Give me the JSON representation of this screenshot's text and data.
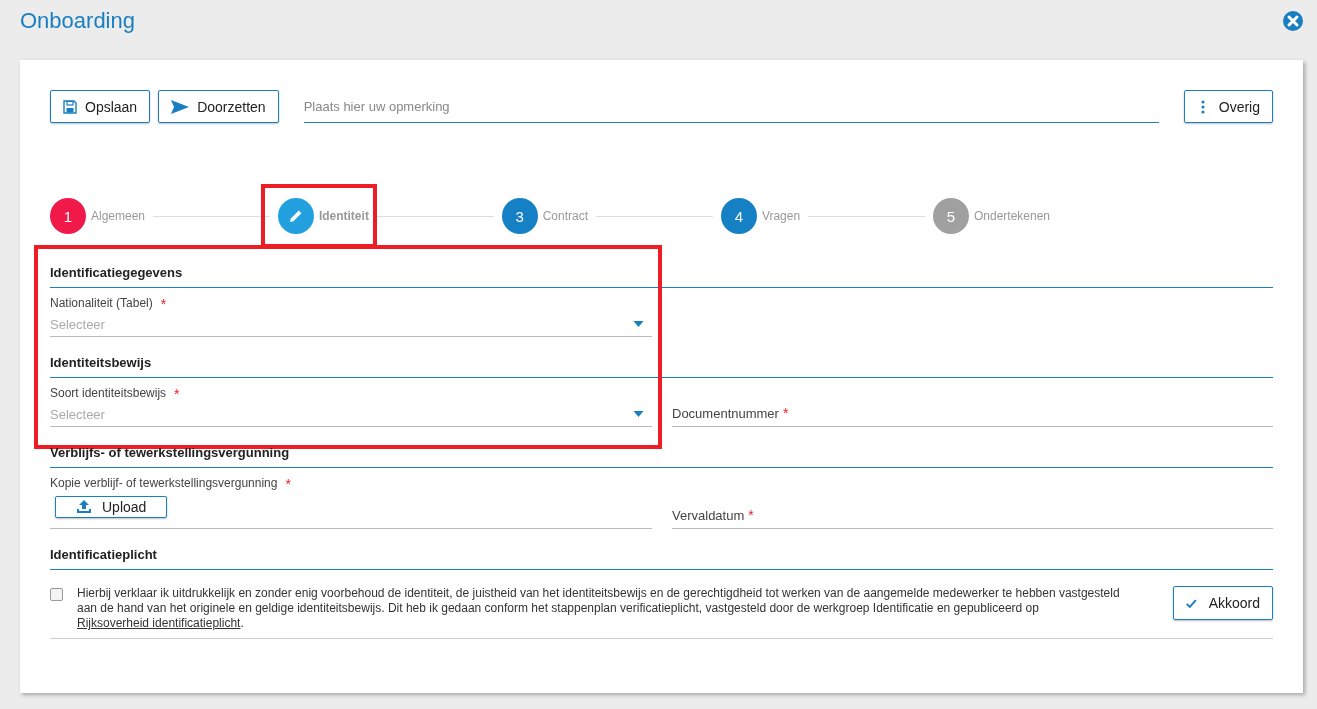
{
  "window": {
    "title": "Onboarding"
  },
  "toolbar": {
    "buttons": [
      {
        "label": "Opslaan",
        "kind": "save"
      },
      {
        "label": "Doorzetten",
        "kind": "send"
      }
    ],
    "remark": {
      "placeholder": "Plaats hier uw opmerking"
    },
    "more_button": {
      "label": "Overig"
    }
  },
  "steps": [
    {
      "kind": "number",
      "number": "1",
      "label": "Algemeen",
      "color": "#f0194a",
      "selected": false,
      "highlighted": false
    },
    {
      "kind": "pencil",
      "label": "Identiteit",
      "color": "#23a0e0",
      "selected": true,
      "highlighted": true
    },
    {
      "kind": "number",
      "number": "3",
      "label": "Contract",
      "color": "#1580c4",
      "selected": false,
      "highlighted": false
    },
    {
      "kind": "number",
      "number": "4",
      "label": "Vragen",
      "color": "#1580c4",
      "selected": false,
      "highlighted": false
    },
    {
      "kind": "number",
      "number": "5",
      "label": "Ondertekenen",
      "color": "#a0a0a0",
      "selected": false,
      "highlighted": false
    }
  ],
  "sections": [
    {
      "title": "Identificatiegegevens",
      "highlighted": true,
      "fields": [
        {
          "kind": "select",
          "label": "Nationaliteit (Tabel)",
          "required_mark": "*",
          "placeholder": "Selecteer"
        }
      ]
    },
    {
      "title": "Identiteitsbewijs",
      "highlighted": true,
      "fields": [
        {
          "kind": "select",
          "label": "Soort identiteitsbewijs",
          "required_mark": "*",
          "placeholder": "Selecteer"
        },
        {
          "kind": "text",
          "label": "Documentnummer",
          "required_mark": "*"
        }
      ]
    },
    {
      "title": "Verblijfs- of tewerkstellingsvergunning",
      "highlighted": false,
      "fields": [
        {
          "kind": "upload",
          "label": "Kopie verblijf- of tewerkstellingsvergunning",
          "required_mark": "*",
          "button": "Upload"
        },
        {
          "kind": "text",
          "label": "Vervaldatum",
          "required_mark": "*"
        }
      ]
    },
    {
      "title": "Identificatieplicht",
      "highlighted": false,
      "declaration": {
        "checked": false,
        "text": "Hierbij verklaar ik uitdrukkelijk en zonder enig voorbehoud de identiteit, de juistheid van het identiteitsbewijs en de gerechtigdheid tot werken van de aangemelde medewerker te hebben vastgesteld aan de hand van het originele en geldige identiteitsbewijs. Dit heb ik gedaan conform het stappenplan verificatieplicht, vastgesteld door de werkgroep Identificatie en gepubliceerd op ",
        "link": "Rijksoverheid identificatieplicht",
        "text_after": ".",
        "button": "Akkoord"
      }
    }
  ]
}
